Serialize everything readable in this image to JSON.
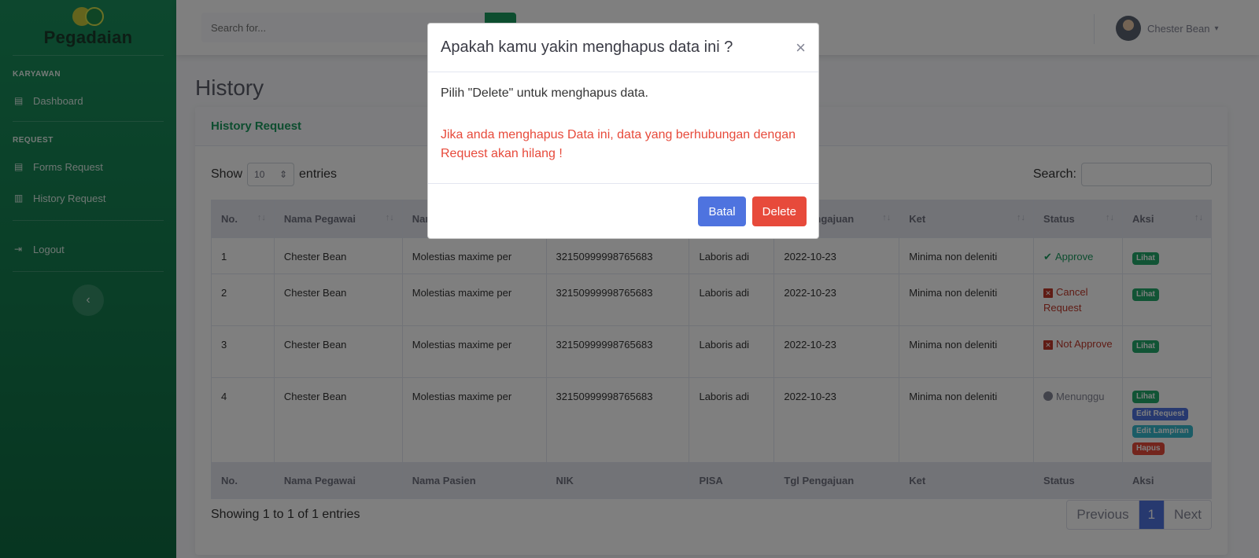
{
  "sidebar": {
    "brand": "Pegadaian",
    "heading_karyawan": "KARYAWAN",
    "dashboard": "Dashboard",
    "heading_request": "REQUEST",
    "forms_request": "Forms Request",
    "history_request": "History Request",
    "logout": "Logout",
    "toggle_glyph": "‹"
  },
  "topbar": {
    "search_placeholder": "Search for...",
    "user_name": "Chester Bean",
    "caret": "▾"
  },
  "page": {
    "title": "History"
  },
  "card": {
    "title": "History Request",
    "show_label": "Show",
    "show_value": "10",
    "entries_label": "entries",
    "search_label": "Search:",
    "showing_text": "Showing 1 to 1 of 1 entries"
  },
  "table": {
    "head": [
      "No.",
      "Nama Pegawai",
      "Nama Pasien",
      "NIK",
      "PISA",
      "Tgl Pengajuan",
      "Ket",
      "Status",
      "Aksi"
    ],
    "sort_glyph": "↑↓",
    "rows": [
      {
        "no": "1",
        "pegawai": "Chester Bean",
        "pasien": "Molestias maxime per",
        "nik": "3215099999876568 3",
        "pisa": "Laboris adi",
        "tgl": "2022-10-23",
        "ket": "Minima non deleniti",
        "status": "Approve"
      },
      {
        "no": "2",
        "pegawai": "Chester Bean",
        "pasien": "Molestias maxime per",
        "nik": "32150999998765683",
        "pisa": "Laboris adi",
        "tgl": "2022-10-23",
        "ket": "Minima non deleniti",
        "status": "Cancel Request"
      },
      {
        "no": "3",
        "pegawai": "Chester Bean",
        "pasien": "Molestias maxime per",
        "nik": "32150999998765683",
        "pisa": "Laboris adi",
        "tgl": "2022-10-23",
        "ket": "Minima non deleniti",
        "status": "Not Approve"
      },
      {
        "no": "4",
        "pegawai": "Chester Bean",
        "pasien": "Molestias maxime per",
        "nik": "32150999998765683",
        "pisa": "Laboris adi",
        "tgl": "2022-10-23",
        "ket": "Minima non deleniti",
        "status": "Menunggu"
      }
    ],
    "actions": {
      "lihat": "Lihat",
      "edit_request": "Edit Request",
      "edit_lampiran": "Edit Lampiran",
      "hapus": "Hapus"
    }
  },
  "pagination": {
    "previous": "Previous",
    "current": "1",
    "next": "Next"
  },
  "modal": {
    "title": "Apakah kamu yakin menghapus data ini ?",
    "close": "×",
    "body": "Pilih \"Delete\" untuk menghapus data.",
    "warning": "Jika anda menghapus Data ini, data yang berhubungan dengan Request akan hilang !",
    "cancel": "Batal",
    "delete": "Delete"
  },
  "colors": {
    "sidebar": "#1a8f5c",
    "primary": "#4e73df",
    "danger": "#e74a3b",
    "success": "#1a9b5f"
  }
}
